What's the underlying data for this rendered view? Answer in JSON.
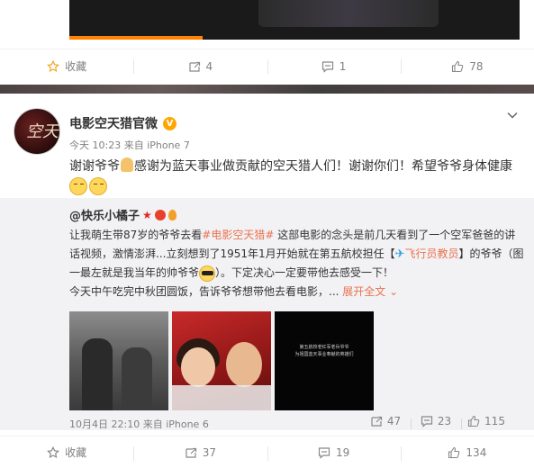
{
  "top_post": {
    "actions": [
      {
        "icon": "star-icon",
        "label": "收藏"
      },
      {
        "icon": "repost-icon",
        "label": "4"
      },
      {
        "icon": "comment-icon",
        "label": "1"
      },
      {
        "icon": "like-icon",
        "label": "78"
      }
    ]
  },
  "post": {
    "author": "电影空天猎官微",
    "verified_badge": "V",
    "avatar_text": "空天",
    "time": "今天 10:23",
    "source": "来自 iPhone 7",
    "text": "谢谢爷爷",
    "text2": "感谢为蓝天事业做贡献的空天猎人们！谢谢你们！希望爷爷身体健康",
    "repost": {
      "author": "@快乐小橘子",
      "text_a": "让我萌生带87岁的爷爷去看",
      "hashtag": "#电影空天猎#",
      "text_b": " 这部电影的念头是前几天看到了一个空军爸爸的讲话视频，激情澎湃...立刻想到了1951年1月开始就在第五航校担任【",
      "link": "飞行员教员",
      "text_c": "】的爷爷（图一最左就是我当年的帅爷爷",
      "text_d": "）。下定决心一定要带他去感受一下！",
      "text_e": "今天中午吃完中秋团圆饭，告诉爷爷想带他去看电影，...",
      "more": "展开全文",
      "thumb3_line1": "第五航校老红军老兵爷爷",
      "thumb3_line2": "为祖国蓝天事业奉献的英雄们",
      "time": "10月4日 22:10",
      "source": "来自 iPhone 6",
      "stats": [
        {
          "icon": "repost-icon",
          "value": "47"
        },
        {
          "icon": "comment-icon",
          "value": "23"
        },
        {
          "icon": "like-icon",
          "value": "115"
        }
      ]
    },
    "actions": [
      {
        "icon": "star-icon",
        "label": "收藏"
      },
      {
        "icon": "repost-icon",
        "label": "37"
      },
      {
        "icon": "comment-icon",
        "label": "19"
      },
      {
        "icon": "like-icon",
        "label": "134"
      }
    ]
  },
  "colors": {
    "accent": "#eb7350",
    "star": "#f5a623",
    "muted": "#808080",
    "progress": "#ff8200"
  }
}
